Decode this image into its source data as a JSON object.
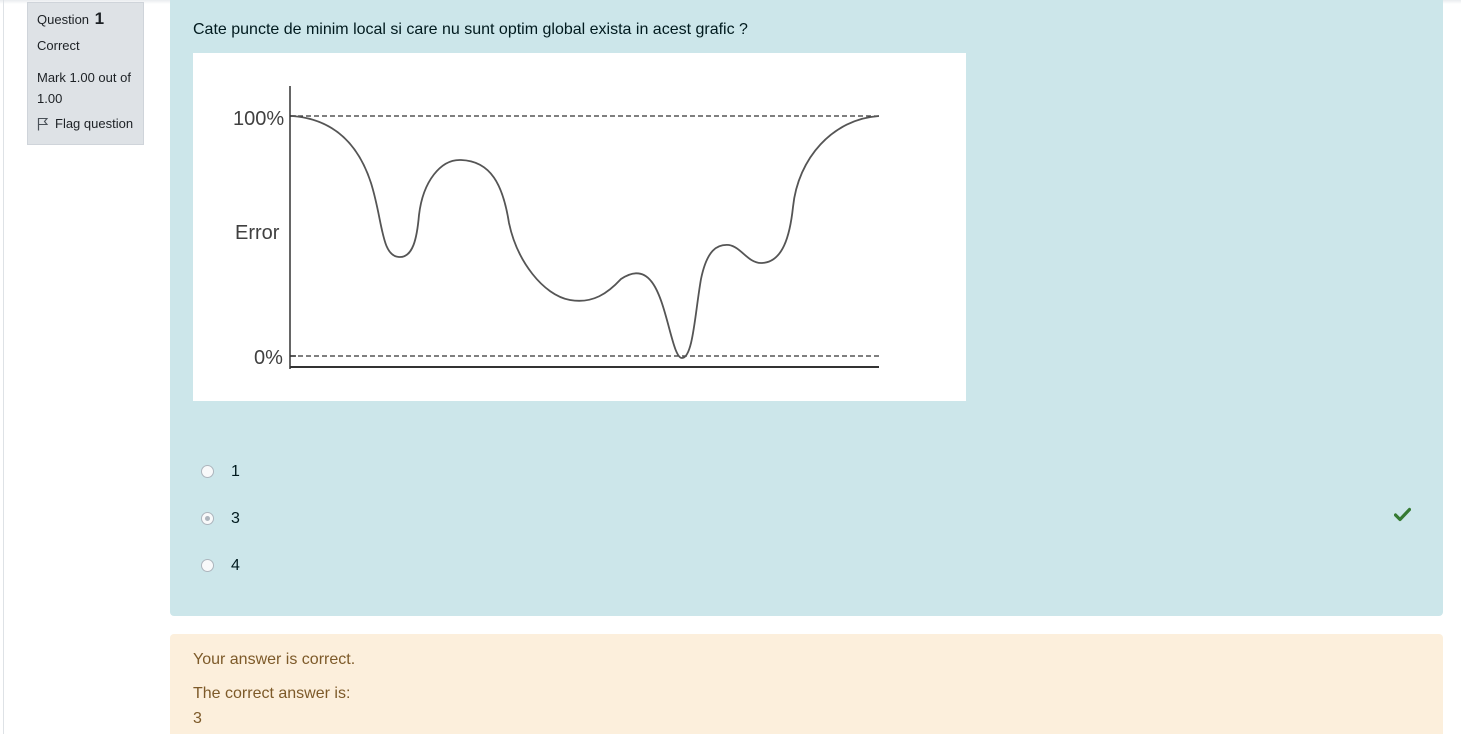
{
  "question_info": {
    "question_label": "Question",
    "question_number": "1",
    "state": "Correct",
    "grade": "Mark 1.00 out of 1.00",
    "flag_label": "Flag question"
  },
  "question": {
    "text": "Cate puncte de minim local si care nu sunt optim global exista in acest grafic ?",
    "figure": {
      "y_tick_top": "100%",
      "y_label": "Error",
      "y_tick_bottom": "0%"
    },
    "answers": [
      {
        "label": "1",
        "selected": false
      },
      {
        "label": "3",
        "selected": true
      },
      {
        "label": "4",
        "selected": false
      }
    ],
    "correct_icon": "check-icon",
    "correct_color": "#357a32"
  },
  "feedback": {
    "outcome": "Your answer is correct.",
    "right_answer_label": "The correct answer is:",
    "right_answer_value": "3"
  },
  "colors": {
    "question_bg": "#cce6ea",
    "feedback_bg": "#fcefdc",
    "info_bg": "#dee2e6"
  }
}
